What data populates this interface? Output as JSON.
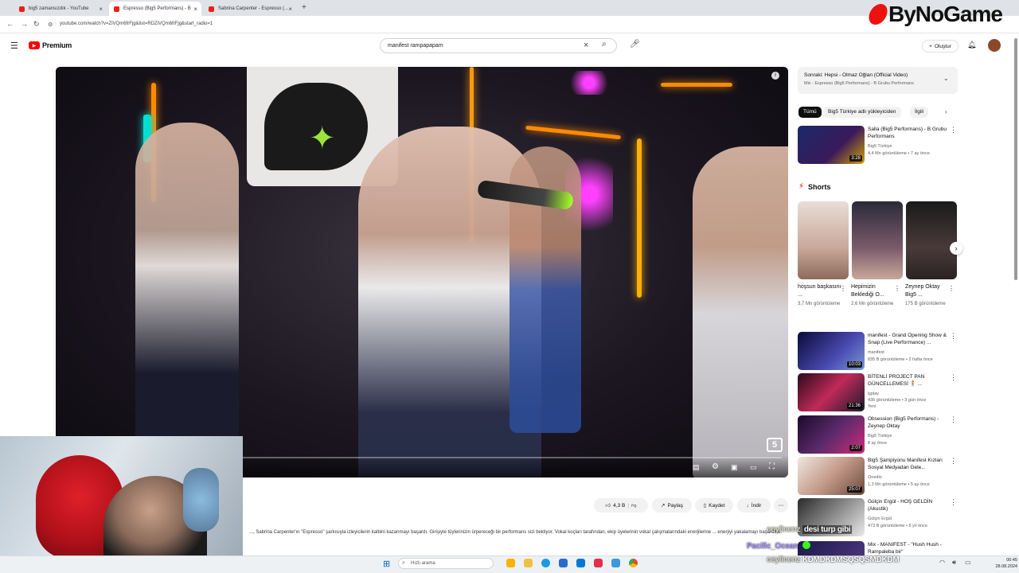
{
  "browser": {
    "tabs": [
      {
        "label": "big5 zamansızdık - YouTube",
        "active": false
      },
      {
        "label": "Espresso (Big5 Performans) - B",
        "active": true
      },
      {
        "label": "Sabrina Carpenter - Espresso (...",
        "active": false
      }
    ],
    "url": "youtube.com/watch?v=ZiVQm6frFjg&list=RDZiVQm6frFjg&start_radio=1"
  },
  "overlay_logo": {
    "text": "ByNoGame"
  },
  "youtube": {
    "logo_text": "Premium",
    "search_value": "manifest rampapapam",
    "create_label": "Oluştur"
  },
  "video": {
    "channel_bug": "5",
    "actions": {
      "likes": "4,3 B",
      "share": "Paylaş",
      "save": "Kaydet",
      "download": "İndir"
    },
    "description": "..., Sabrina Carpenter'ın \"Espresso\" şarkısıyla izleyicilerin kalbini kazanmayı başardı. Girişiyle tüylerinizin ürpereceği bir performans sizi bekliyor. Vokal koçları tarafından, ekip üyelerinin vokal çalışmalarındaki enerjilerine ... enerjiyi yakalamayı başardılar."
  },
  "sidebar": {
    "next": {
      "title": "Sonraki: Hepsi - Olmaz Oğlan (Official Video)",
      "subtitle": "Mix - Espresso (Big5 Performans) - B Grubu Performans"
    },
    "chips": [
      "Tümü",
      "Big5 Türkiye adlı yükleyiciden",
      "İlgili"
    ],
    "first_card": {
      "title": "Salla (Big5 Performans) - B Grubu Performans",
      "channel": "Big5 Türkiye",
      "meta": "4,4 Mn görüntüleme • 7 ay önce",
      "duration": "3:28"
    },
    "shorts_label": "Shorts",
    "shorts": [
      {
        "title": "hoşsun başkasını ...",
        "views": "3,7 Mn görüntüleme"
      },
      {
        "title": "Hepimizin Beklediği O...",
        "views": "2,6 Mn görüntüleme"
      },
      {
        "title": "Zeynep Oktay Big5 ...",
        "views": "175 B görüntüleme"
      }
    ],
    "cards": [
      {
        "title": "manifest - Grand Opening Show & Snap (Live Performance) ...",
        "channel": "manifest",
        "meta": "835 B görüntüleme • 2 hafta önce",
        "duration": "10:03"
      },
      {
        "title": "BİTENLİ PROJECT PAN GÜNCELLEMESİ 🧍 ...",
        "channel": "lşplay",
        "meta": "436 görüntüleme • 3 gün önce",
        "extra": "Yeni",
        "duration": "21:36"
      },
      {
        "title": "Obsession (Big5 Performans) - Zeynep Oktay",
        "channel": "Big5 Türkiye",
        "meta": "8 ay önce",
        "duration": "2:07"
      },
      {
        "title": "Big5 Şampiyonu Manifest Kızları Sosyal Medyadan Gele...",
        "channel": "Onedio",
        "meta": "1,3 Mn görüntüleme • 5 ay önce",
        "duration": "25:07"
      },
      {
        "title": "Gülçin Ergül - HOŞ GELDİN (Akustik)",
        "channel": "Gülçin Ergül",
        "meta": "473 B görüntüleme • 6 yıl önce",
        "duration": ""
      },
      {
        "title": "Mix - MANIFEST - \"Hush Hush - Rampaleba bir\"",
        "channel": "",
        "meta": "",
        "duration": ""
      }
    ]
  },
  "chat_overlay": [
    {
      "user": "ceylinenz",
      "text": "desi turp gibi"
    },
    {
      "user": "Pacific_Ocean",
      "text": ""
    },
    {
      "user": "ceylinenz",
      "text": "KDMDKDMSQSQSMDKDM"
    }
  ],
  "taskbar": {
    "search_placeholder": "Hızlı arama",
    "time": "00:45",
    "date": "28.08.2024"
  },
  "colors": {
    "youtube_red": "#ff0000",
    "logo_red": "#e11111",
    "chat_green": "#39ff14"
  }
}
